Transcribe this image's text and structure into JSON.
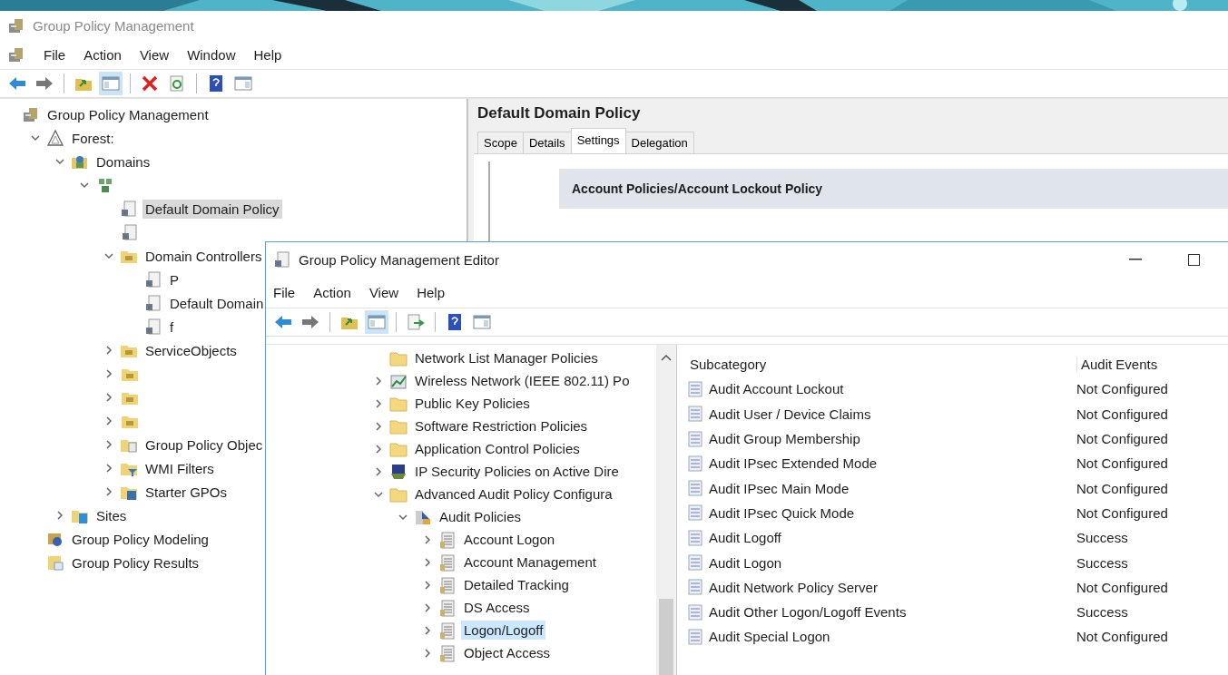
{
  "main_window": {
    "title": "Group Policy Management",
    "menu": [
      "File",
      "Action",
      "View",
      "Window",
      "Help"
    ],
    "toolbar": [
      {
        "kind": "back",
        "pressed": false
      },
      {
        "kind": "forward",
        "pressed": false
      },
      {
        "kind": "sep"
      },
      {
        "kind": "up",
        "pressed": false
      },
      {
        "kind": "tree",
        "pressed": true
      },
      {
        "kind": "sep"
      },
      {
        "kind": "delete",
        "pressed": false
      },
      {
        "kind": "refresh",
        "pressed": false
      },
      {
        "kind": "sep"
      },
      {
        "kind": "help",
        "pressed": false
      },
      {
        "kind": "panel",
        "pressed": false
      }
    ],
    "tree": [
      {
        "label": "Group Policy Management",
        "kind": "root",
        "selected": false,
        "children": [
          {
            "label": "Forest:",
            "kind": "forest",
            "expanded": true,
            "selected": false,
            "children": [
              {
                "label": "Domains",
                "kind": "domains",
                "expanded": true,
                "selected": false,
                "children": [
                  {
                    "kind": "domain",
                    "expanded": true,
                    "selected": false,
                    "children": [
                      {
                        "label": "Default Domain Policy",
                        "kind": "gpo",
                        "selected": true
                      },
                      {
                        "kind": "gpo",
                        "selected": false
                      },
                      {
                        "label": "Domain Controllers",
                        "kind": "ou",
                        "expanded": true,
                        "selected": false,
                        "children": [
                          {
                            "label": "P",
                            "kind": "gpo",
                            "selected": false
                          },
                          {
                            "label": "Default Domain",
                            "kind": "gpo",
                            "selected": false
                          },
                          {
                            "label": "f",
                            "kind": "gpo",
                            "selected": false
                          }
                        ]
                      },
                      {
                        "label": "ServiceObjects",
                        "kind": "ou",
                        "expanded": false,
                        "selected": false
                      },
                      {
                        "kind": "ou",
                        "expanded": false,
                        "selected": false
                      },
                      {
                        "kind": "ou",
                        "expanded": false,
                        "selected": false
                      },
                      {
                        "kind": "ou",
                        "expanded": false,
                        "selected": false
                      },
                      {
                        "label": "Group Policy Objec",
                        "kind": "gpofolder",
                        "expanded": false,
                        "selected": false
                      },
                      {
                        "label": "WMI Filters",
                        "kind": "wmi",
                        "expanded": false,
                        "selected": false
                      },
                      {
                        "label": "Starter GPOs",
                        "kind": "starter",
                        "expanded": false,
                        "selected": false
                      }
                    ]
                  }
                ]
              },
              {
                "label": "Sites",
                "kind": "sites",
                "expanded": false,
                "selected": false
              }
            ]
          },
          {
            "label": "Group Policy Modeling",
            "kind": "modeling",
            "selected": false
          },
          {
            "label": "Group Policy Results",
            "kind": "results",
            "selected": false
          }
        ]
      }
    ],
    "details": {
      "title": "Default Domain Policy",
      "tabs": [
        {
          "label": "Scope",
          "selected": false
        },
        {
          "label": "Details",
          "selected": false
        },
        {
          "label": "Settings",
          "selected": true
        },
        {
          "label": "Delegation",
          "selected": false
        }
      ],
      "section": "Account Policies/Account Lockout Policy"
    }
  },
  "editor_window": {
    "title": "Group Policy Management Editor",
    "menu": [
      "File",
      "Action",
      "View",
      "Help"
    ],
    "toolbar": [
      {
        "kind": "back",
        "pressed": false
      },
      {
        "kind": "forward",
        "pressed": false
      },
      {
        "kind": "sep"
      },
      {
        "kind": "up",
        "pressed": false
      },
      {
        "kind": "tree",
        "pressed": true
      },
      {
        "kind": "sep"
      },
      {
        "kind": "export",
        "pressed": false
      },
      {
        "kind": "sep"
      },
      {
        "kind": "help",
        "pressed": false
      },
      {
        "kind": "panel",
        "pressed": false
      }
    ],
    "tree": [
      {
        "label": "Network List Manager Policies",
        "kind": "folder",
        "selected": false
      },
      {
        "label": "Wireless Network (IEEE 802.11) Po",
        "kind": "wireless",
        "expanded": false,
        "selected": false
      },
      {
        "label": "Public Key Policies",
        "kind": "folder",
        "expanded": false,
        "selected": false
      },
      {
        "label": "Software Restriction Policies",
        "kind": "folder",
        "expanded": false,
        "selected": false
      },
      {
        "label": "Application Control Policies",
        "kind": "folder",
        "expanded": false,
        "selected": false
      },
      {
        "label": "IP Security Policies on Active Dire",
        "kind": "ipsec",
        "expanded": false,
        "selected": false
      },
      {
        "label": "Advanced Audit Policy Configura",
        "kind": "folder",
        "expanded": true,
        "selected": false,
        "children": [
          {
            "label": "Audit Policies",
            "kind": "audit",
            "expanded": true,
            "selected": false,
            "children": [
              {
                "label": "Account Logon",
                "kind": "category",
                "expanded": false,
                "selected": false
              },
              {
                "label": "Account Management",
                "kind": "category",
                "expanded": false,
                "selected": false
              },
              {
                "label": "Detailed Tracking",
                "kind": "category",
                "expanded": false,
                "selected": false
              },
              {
                "label": "DS Access",
                "kind": "category",
                "expanded": false,
                "selected": false
              },
              {
                "label": "Logon/Logoff",
                "kind": "category",
                "expanded": false,
                "selected": true
              },
              {
                "label": "Object Access",
                "kind": "category",
                "expanded": false,
                "selected": false
              }
            ]
          }
        ]
      }
    ],
    "table": {
      "columns": [
        "Subcategory",
        "Audit Events"
      ],
      "rows": [
        [
          "Audit Account Lockout",
          "Not Configured"
        ],
        [
          "Audit User / Device Claims",
          "Not Configured"
        ],
        [
          "Audit Group Membership",
          "Not Configured"
        ],
        [
          "Audit IPsec Extended Mode",
          "Not Configured"
        ],
        [
          "Audit IPsec Main Mode",
          "Not Configured"
        ],
        [
          "Audit IPsec Quick Mode",
          "Not Configured"
        ],
        [
          "Audit Logoff",
          "Success"
        ],
        [
          "Audit Logon",
          "Success"
        ],
        [
          "Audit Network Policy Server",
          "Not Configured"
        ],
        [
          "Audit Other Logon/Logoff Events",
          "Success"
        ],
        [
          "Audit Special Logon",
          "Not Configured"
        ]
      ]
    }
  }
}
